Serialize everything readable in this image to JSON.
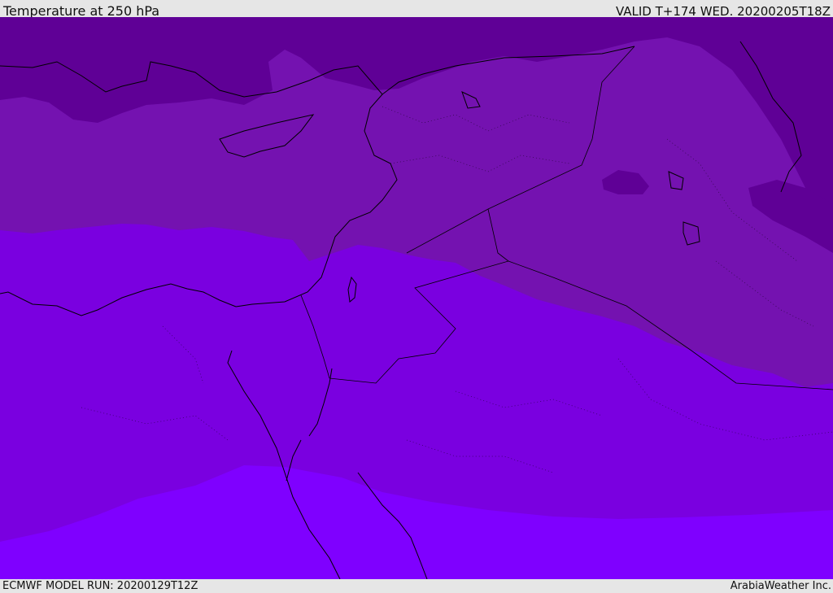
{
  "header": {
    "title": "Temperature at 250 hPa",
    "valid_time": "VALID T+174 WED. 20200205T18Z"
  },
  "footer": {
    "model_run": "ECMWF MODEL RUN: 20200129T12Z",
    "credit": "ArabiaWeather Inc."
  },
  "map": {
    "colors": {
      "coldest": "#5f0096",
      "cold": "#7412b0",
      "mid": "#7a00e0",
      "warm": "#7f00ff",
      "coastline": "#000000"
    }
  }
}
